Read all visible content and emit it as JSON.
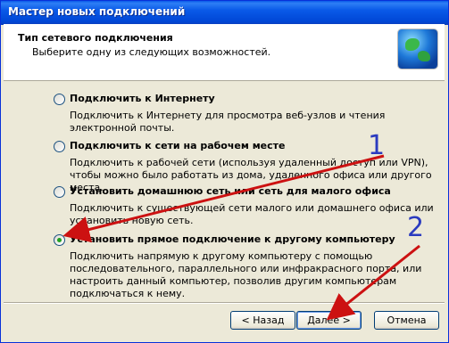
{
  "window": {
    "title": "Мастер новых подключений"
  },
  "header": {
    "title": "Тип сетевого подключения",
    "subtitle": "Выберите одну из следующих возможностей."
  },
  "options": [
    {
      "label": "Подключить к Интернету",
      "description": "Подключить к Интернету для просмотра веб-узлов и чтения  электронной почты.",
      "checked": false
    },
    {
      "label": "Подключить к сети на рабочем месте",
      "description": "Подключить к рабочей сети (используя удаленный доступ или VPN), чтобы можно было работать из дома, удаленного офиса или другого места.",
      "checked": false
    },
    {
      "label": "Установить домашнюю сеть или сеть для малого офиса",
      "description": "Подключить к существующей сети малого или домашнего офиса или установить новую сеть.",
      "checked": false
    },
    {
      "label": "Установить прямое подключение к другому компьютеру",
      "description": "Подключить напрямую к другому компьютеру с помощью последовательного, параллельного или инфракрасного порта, или настроить данный компьютер, позволив другим  компьютерам подключаться к нему.",
      "checked": true
    }
  ],
  "buttons": {
    "back": "< Назад",
    "next": "Далее >",
    "cancel": "Отмена"
  },
  "annotations": {
    "one": "1",
    "two": "2",
    "color": "#cc1111"
  },
  "icons": {
    "globe": "globe-network-icon"
  }
}
